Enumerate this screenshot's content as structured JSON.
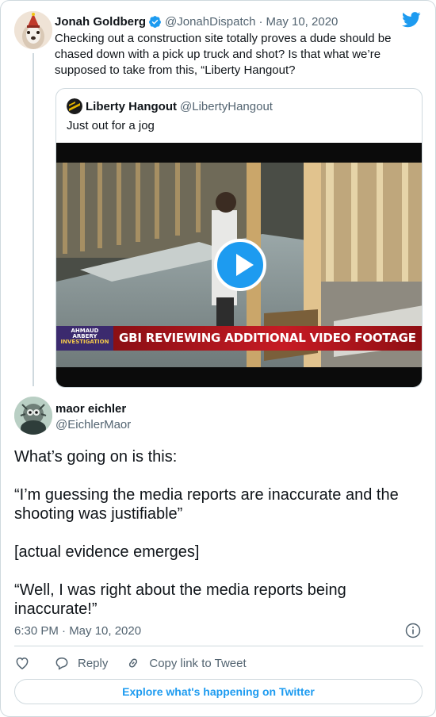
{
  "parent_tweet": {
    "author_name": "Jonah Goldberg",
    "handle": "@JonahDispatch",
    "separator": "·",
    "date": "May 10, 2020",
    "text": "Checking out a construction site totally proves a dude should be chased down with a pick up truck and shot? Is that what we’re supposed to take from this, “Liberty Hangout?"
  },
  "quoted_tweet": {
    "author_name": "Liberty Hangout",
    "handle": "@LibertyHangout",
    "text": "Just out for a jog",
    "video": {
      "chyron_tag_line1": "AHMAUD",
      "chyron_tag_line2": "ARBERY",
      "chyron_tag_line3": "INVESTIGATION",
      "chyron_headline": "GBI REVIEWING ADDITIONAL VIDEO FOOTAGE"
    }
  },
  "main_tweet": {
    "author_name": "maor eichler",
    "handle": "@EichlerMaor",
    "paragraphs": [
      "What’s going on is this:",
      "“I’m guessing the media reports are inaccurate and the shooting was justifiable”",
      "[actual evidence emerges]",
      "“Well, I was right about the media reports being inaccurate!”"
    ],
    "timestamp": "6:30 PM · May 10, 2020"
  },
  "actions": {
    "reply_label": "Reply",
    "copy_link_label": "Copy link to Tweet"
  },
  "explore_label": "Explore what's happening on Twitter",
  "colors": {
    "accent": "#1d9bf0",
    "text_primary": "#0f1419",
    "text_secondary": "#536471",
    "border": "#cfd9de"
  },
  "icons": [
    "verified-badge-icon",
    "twitter-bird-icon",
    "play-icon",
    "info-icon",
    "heart-icon",
    "reply-icon",
    "link-icon"
  ]
}
